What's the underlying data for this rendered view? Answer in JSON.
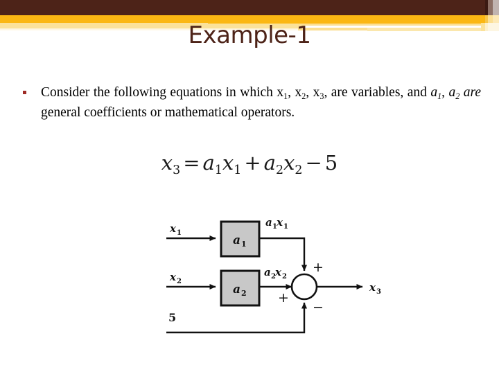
{
  "slide": {
    "title": "Example-1",
    "theme": {
      "title_color": "#4d2318",
      "band_brown": "#4d2318",
      "band_orange": "#fbb713",
      "band_pale": "#fbe29a",
      "bullet_color": "#9e2b25"
    }
  },
  "body": {
    "bullet": {
      "marker": "square-bullet",
      "segments": [
        {
          "text": "Consider the following equations in which x",
          "style": "normal"
        },
        {
          "text": "1",
          "style": "subscript"
        },
        {
          "text": ", x",
          "style": "normal"
        },
        {
          "text": "2",
          "style": "subscript"
        },
        {
          "text": ", x",
          "style": "normal"
        },
        {
          "text": "3",
          "style": "subscript"
        },
        {
          "text": ", are variables, and ",
          "style": "normal"
        },
        {
          "text": "a",
          "style": "italic"
        },
        {
          "text": "1",
          "style": "italic-subscript"
        },
        {
          "text": ", ",
          "style": "normal"
        },
        {
          "text": "a",
          "style": "italic"
        },
        {
          "text": "2",
          "style": "italic-subscript"
        },
        {
          "text": " are ",
          "style": "italic"
        },
        {
          "text": "general coefficients or mathematical operators.",
          "style": "normal"
        }
      ],
      "plain_text": "Consider the following equations in which x1, x2, x3, are variables, and a1, a2 are general coefficients or mathematical operators."
    }
  },
  "equation": {
    "plain_text": "x3 = a1x1 + a2x2 - 5",
    "lhs": "x",
    "lhs_sub": "3",
    "equals": "=",
    "term1_coeff": "a",
    "term1_coeff_sub": "1",
    "term1_var": "x",
    "term1_var_sub": "1",
    "plus": "+",
    "term2_coeff": "a",
    "term2_coeff_sub": "2",
    "term2_var": "x",
    "term2_var_sub": "2",
    "minus": "−",
    "constant": "5"
  },
  "diagram": {
    "type": "block-diagram",
    "inputs": [
      {
        "label": "x",
        "sub": "1"
      },
      {
        "label": "x",
        "sub": "2"
      },
      {
        "label": "5",
        "sub": ""
      }
    ],
    "blocks": [
      {
        "label": "a",
        "sub": "1",
        "fill": "#c8c8c8"
      },
      {
        "label": "a",
        "sub": "2",
        "fill": "#c8c8c8"
      }
    ],
    "block_outputs": [
      {
        "coeff": "a",
        "coeff_sub": "1",
        "var": "x",
        "var_sub": "1"
      },
      {
        "coeff": "a",
        "coeff_sub": "2",
        "var": "x",
        "var_sub": "2"
      }
    ],
    "summing_junction": {
      "signs": {
        "top": "+",
        "left": "+",
        "bottom": "−"
      }
    },
    "output": {
      "label": "x",
      "sub": "3"
    }
  }
}
